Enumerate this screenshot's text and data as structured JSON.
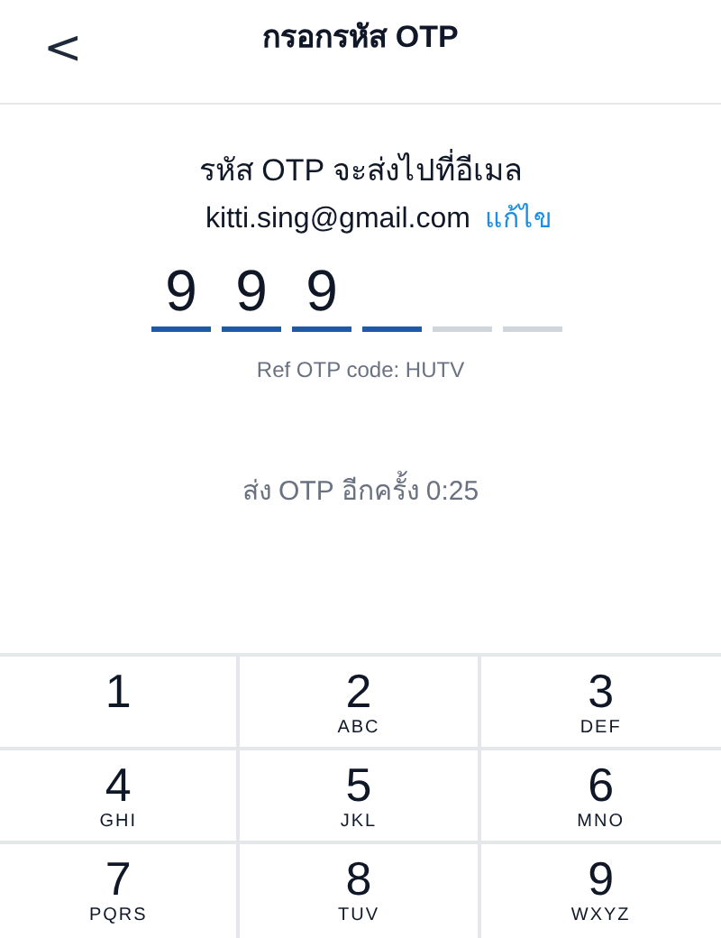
{
  "header": {
    "back": "<",
    "title": "กรอกรหัส OTP"
  },
  "message": "รหัส OTP จะส่งไปที่อีเมล",
  "email": "kitti.sing@gmail.com",
  "edit_link": "แก้ไข",
  "otp_slots": [
    {
      "digit": "9",
      "active": true
    },
    {
      "digit": "9",
      "active": true
    },
    {
      "digit": "9",
      "active": true
    },
    {
      "active": true
    },
    {
      "active": false
    },
    {
      "active": false
    }
  ],
  "ref_code": "Ref OTP code: HUTV",
  "resend": "ส่ง OTP อีกครั้ง 0:25",
  "keypad": [
    {
      "digit": "1"
    },
    {
      "digit": "2",
      "letters": "ABC"
    },
    {
      "digit": "3",
      "letters": "DEF"
    },
    {
      "digit": "4",
      "letters": "GHI"
    },
    {
      "digit": "5",
      "letters": "JKL"
    },
    {
      "digit": "6",
      "letters": "MNO"
    },
    {
      "digit": "7",
      "letters": "PQRS"
    },
    {
      "digit": "8",
      "letters": "TUV"
    },
    {
      "digit": "9",
      "letters": "WXYZ"
    }
  ]
}
